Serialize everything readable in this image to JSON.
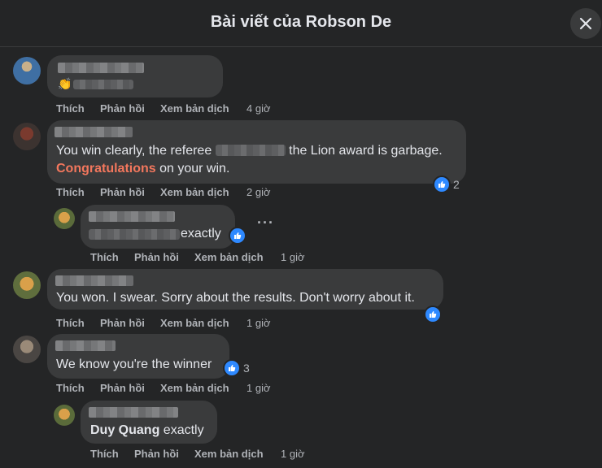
{
  "dialog": {
    "title": "Bài viết của Robson De"
  },
  "actions": {
    "like": "Thích",
    "reply": "Phản hồi",
    "translate": "Xem bản dịch"
  },
  "comments": [
    {
      "time": "4 giờ"
    },
    {
      "line1_a": "You win clearly, the referee ",
      "line1_b": " the Lion award is garbage.",
      "line2_highlight": "Congratulations",
      "line2_rest": " on your win.",
      "time": "2 giờ",
      "reactions": "2"
    },
    {
      "text": "exactly",
      "time": "1 giờ"
    },
    {
      "text": "You won. I swear. Sorry about the results. Don't worry about it.",
      "time": "1 giờ"
    },
    {
      "text": "We know you're the winner",
      "time": "1 giờ",
      "reactions": "3"
    },
    {
      "mention": "Duy Quang",
      "text": " exactly",
      "time": "1 giờ"
    }
  ],
  "icons": {
    "close": "close-icon",
    "like": "like-icon",
    "more": "more-options-icon"
  },
  "colors": {
    "background": "#242526",
    "bubble": "#3a3b3c",
    "accent": "#2e89ff",
    "highlight": "#f3775d"
  }
}
